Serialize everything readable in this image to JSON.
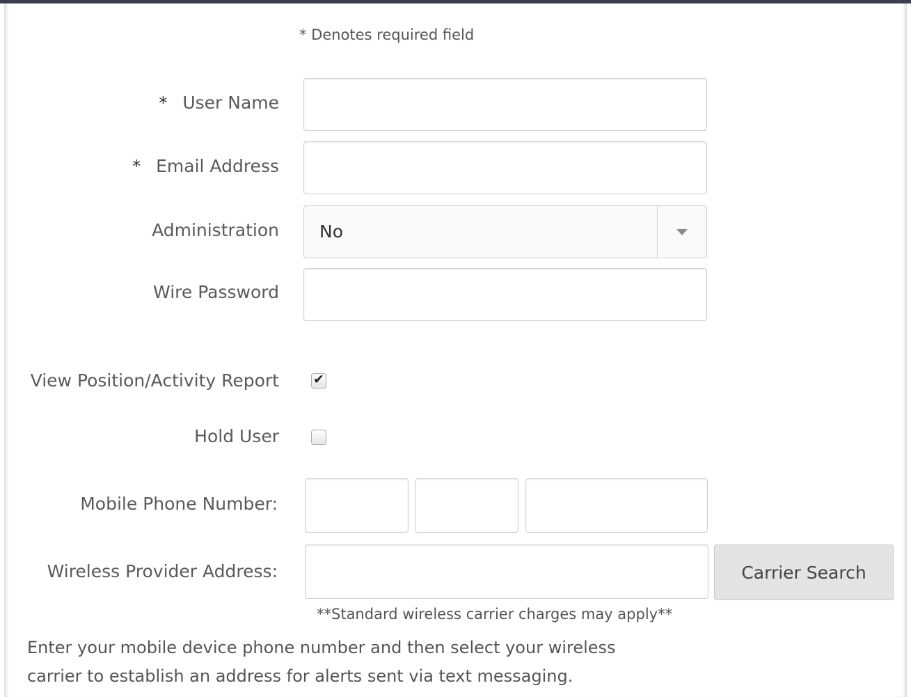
{
  "form": {
    "required_note": "* Denotes required field",
    "required_marker": "*",
    "user_name": {
      "label": "User Name",
      "value": ""
    },
    "email": {
      "label": "Email Address",
      "value": ""
    },
    "administration": {
      "label": "Administration",
      "value": "No"
    },
    "wire_password": {
      "label": "Wire Password",
      "value": ""
    },
    "view_report": {
      "label": "View Position/Activity Report",
      "checked": true
    },
    "hold_user": {
      "label": "Hold User",
      "checked": false
    },
    "mobile_phone": {
      "label": "Mobile Phone Number:",
      "part1": "",
      "part2": "",
      "part3": ""
    },
    "wireless_provider": {
      "label": "Wireless Provider Address:",
      "value": ""
    },
    "carrier_search_button": "Carrier Search",
    "charges_note": "**Standard wireless carrier charges may apply**",
    "help_text_line1": "Enter your mobile device phone number and then select your wireless",
    "help_text_line2": "carrier to establish an address for alerts sent via text messaging."
  },
  "colors": {
    "top_rule": "#3d3d4d",
    "button_bg": "#e4e4e4",
    "label_text": "#5a5a5a"
  },
  "icons": {
    "check": "check-icon",
    "dropdown": "caret-down-icon"
  }
}
